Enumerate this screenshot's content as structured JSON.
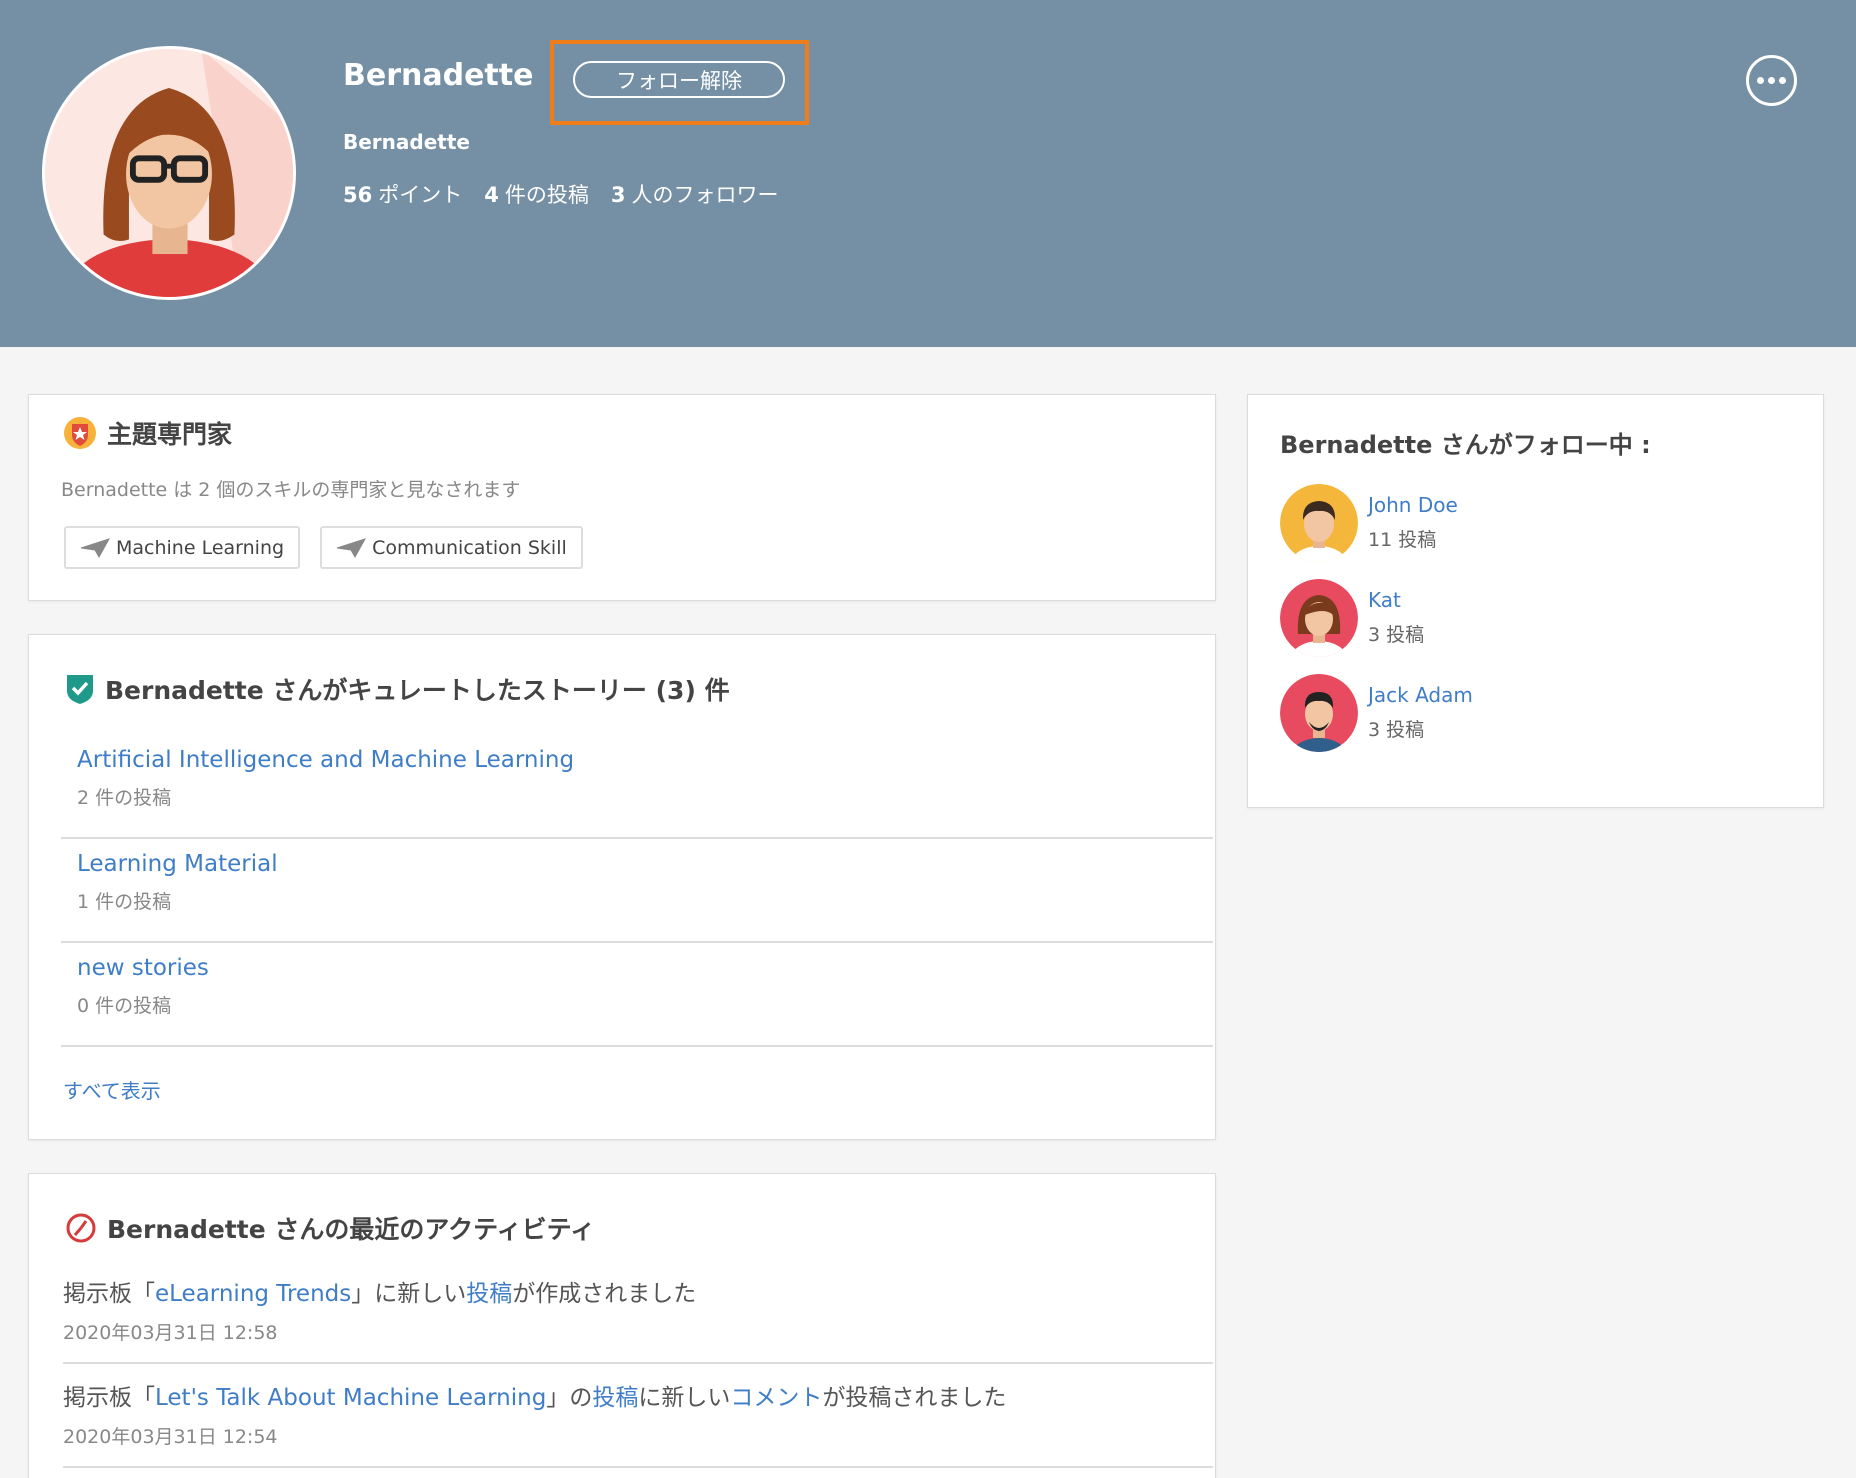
{
  "profile": {
    "name": "Bernadette",
    "username": "Bernadette",
    "unfollow_label": "フォロー解除",
    "stats": [
      {
        "value": "56",
        "label": "ポイント"
      },
      {
        "value": "4",
        "label": "件の投稿"
      },
      {
        "value": "3",
        "label": "人のフォロワー"
      }
    ]
  },
  "expert": {
    "title": "主題専門家",
    "description": "Bernadette は 2 個のスキルの専門家と見なされます",
    "skills": [
      "Machine Learning",
      "Communication Skill"
    ]
  },
  "stories": {
    "title": "Bernadette さんがキュレートしたストーリー (3) 件",
    "items": [
      {
        "title": "Artificial Intelligence and Machine Learning",
        "count": "2 件の投稿"
      },
      {
        "title": "Learning Material",
        "count": "1 件の投稿"
      },
      {
        "title": "new stories",
        "count": "0 件の投稿"
      }
    ],
    "see_all": "すべて表示"
  },
  "activity": {
    "title": "Bernadette さんの最近のアクティビティ",
    "items": [
      {
        "prefix": "掲示板「",
        "board": "eLearning Trends",
        "mid": "」に新しい",
        "link": "投稿",
        "suffix": "が作成されました",
        "date": "2020年03月31日 12:58"
      },
      {
        "prefix": "掲示板「",
        "board": "Let's Talk About Machine Learning",
        "mid": "」の",
        "link": "投稿",
        "mid2": "に新しい",
        "link2": "コメント",
        "suffix": "が投稿されました",
        "date": "2020年03月31日 12:54"
      }
    ]
  },
  "following": {
    "title": "Bernadette さんがフォロー中 :",
    "users": [
      {
        "name": "John Doe",
        "posts": "11 投稿",
        "color": "#f5b73b"
      },
      {
        "name": "Kat",
        "posts": "3 投稿",
        "color": "#e84a5f"
      },
      {
        "name": "Jack Adam",
        "posts": "3 投稿",
        "color": "#e84a5f"
      }
    ]
  },
  "colors": {
    "banner": "#7590a5",
    "link": "#3f7dc7",
    "highlight": "#ef7d1a"
  }
}
